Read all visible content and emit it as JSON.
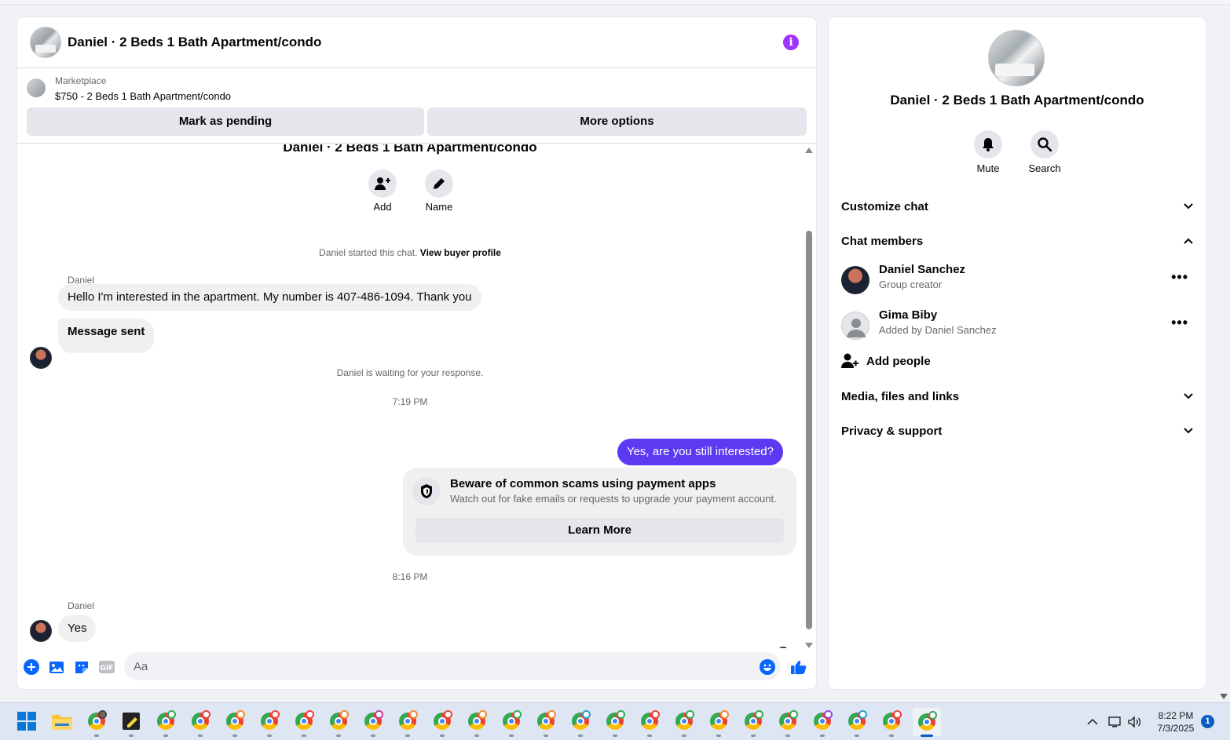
{
  "chat": {
    "title": "Daniel · 2 Beds 1 Bath Apartment/condo",
    "listing": {
      "label": "Marketplace",
      "price_title": "$750 - 2 Beds 1 Bath Apartment/condo",
      "pending_button": "Mark as pending",
      "options_button": "More options"
    },
    "thread_title": "Daniel · 2 Beds 1 Bath Apartment/condo",
    "actions": {
      "add_label": "Add",
      "name_label": "Name"
    },
    "started_text": "Daniel started this chat.",
    "started_link": "View buyer profile",
    "messages": [
      {
        "sender": "Daniel",
        "text": "Hello I'm interested in the apartment. My number is 407-486-1094.  Thank you"
      },
      {
        "text": "Message sent"
      }
    ],
    "waiting_text": "Daniel is waiting for your response.",
    "time1": "7:19 PM",
    "outgoing": "Yes, are you still interested?",
    "scam": {
      "title": "Beware of common scams using payment apps",
      "subtitle": "Watch out for fake emails or requests to upgrade your payment account.",
      "button": "Learn More"
    },
    "time2": "8:16 PM",
    "reply_sender": "Daniel",
    "reply": "Yes",
    "composer_placeholder": "Aa"
  },
  "side": {
    "title": "Daniel · 2 Beds 1 Bath Apartment/condo",
    "mute_label": "Mute",
    "search_label": "Search",
    "customize": "Customize chat",
    "members_heading": "Chat members",
    "members": [
      {
        "name": "Daniel Sanchez",
        "sub": "Group creator"
      },
      {
        "name": "Gima Biby",
        "sub": "Added by Daniel Sanchez"
      }
    ],
    "add_people": "Add people",
    "media": "Media, files and links",
    "privacy": "Privacy & support"
  },
  "taskbar": {
    "time": "8:22 PM",
    "date": "7/3/2025",
    "notification_count": "1"
  },
  "colors": {
    "accent": "#5b3af2",
    "info": "#a033ff",
    "link_blue": "#0866ff"
  }
}
